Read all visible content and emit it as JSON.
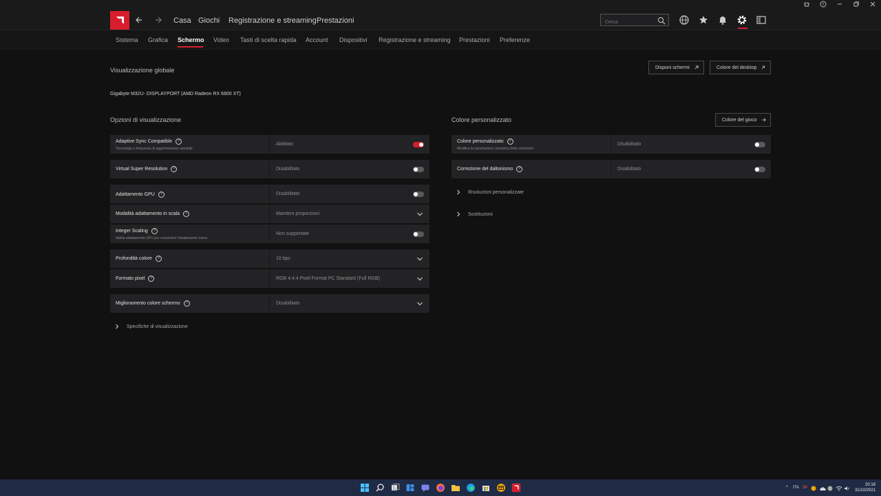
{
  "window": {
    "controls": [
      "bug-icon",
      "help-icon",
      "minimize-icon",
      "restore-icon",
      "close-icon"
    ]
  },
  "topnav": {
    "items": [
      "Casa",
      "Giochi",
      "Registrazione e streaming",
      "Prestazioni"
    ],
    "search_placeholder": "Cerca"
  },
  "subnav": {
    "items": [
      "Sistema",
      "Grafica",
      "Schermo",
      "Video",
      "Tasti di scelta rapida",
      "Account",
      "Dispositivi",
      "Registrazione e streaming",
      "Prestazioni",
      "Preferenze"
    ],
    "active": "Schermo"
  },
  "global": {
    "title": "Visualizzazione globale",
    "btn_disponi": "Disponi schermi",
    "btn_colore_desktop": "Colore del desktop",
    "monitor": "Gigabyte M32U- DISPLAYPORT (AMD Radeon RX 6800 XT)"
  },
  "display_options": {
    "title": "Opzioni di visualizzazione",
    "adaptive_sync": {
      "label": "Adaptive Sync Compatible",
      "desc": "Tecnologia a frequenza di aggiornamento variabile",
      "value": "Abilitato",
      "on": true
    },
    "vsr": {
      "label": "Virtual Super Resolution",
      "value": "Disabilitato",
      "on": false
    },
    "gpu_scaling": {
      "label": "Adattamento GPU",
      "value": "Disabilitato",
      "on": false
    },
    "scaling_mode": {
      "label": "Modalità adattamento in scala",
      "value": "Mantieni proporzioni"
    },
    "integer_scaling": {
      "label": "Integer Scaling",
      "desc": "Abilita adattamento GPU per consentire l'adattamento intero",
      "value": "Non supportate",
      "on": false
    },
    "color_depth": {
      "label": "Profondità colore",
      "value": "10 bpc"
    },
    "pixel_format": {
      "label": "Formato pixel",
      "value": "RGB 4:4:4 Pixel Format PC Standard (Full RGB)"
    },
    "color_enhance": {
      "label": "Miglioramento colore schermo",
      "value": "Disabilitato"
    },
    "specs_link": "Specifiche di visualizzazione"
  },
  "custom_color": {
    "title": "Colore personalizzato",
    "btn_colore_gioco": "Colore del gioco",
    "custom": {
      "label": "Colore personalizzato",
      "desc": "Modifica la riproduzione cromatica dello schermo/i",
      "value": "Disabilitato",
      "on": false
    },
    "daltonism": {
      "label": "Correzione del daltonismo",
      "value": "Disabilitato",
      "on": false
    },
    "custom_res_link": "Risoluzioni personalizzate",
    "overrides_link": "Sostituzioni"
  },
  "taskbar": {
    "tray_lang": "ITA",
    "tray_num": "38",
    "time": "20:18",
    "date": "31/10/2021"
  },
  "colors": {
    "accent": "#d81e2c",
    "row_bg": "#232325",
    "page_bg": "#111112"
  }
}
